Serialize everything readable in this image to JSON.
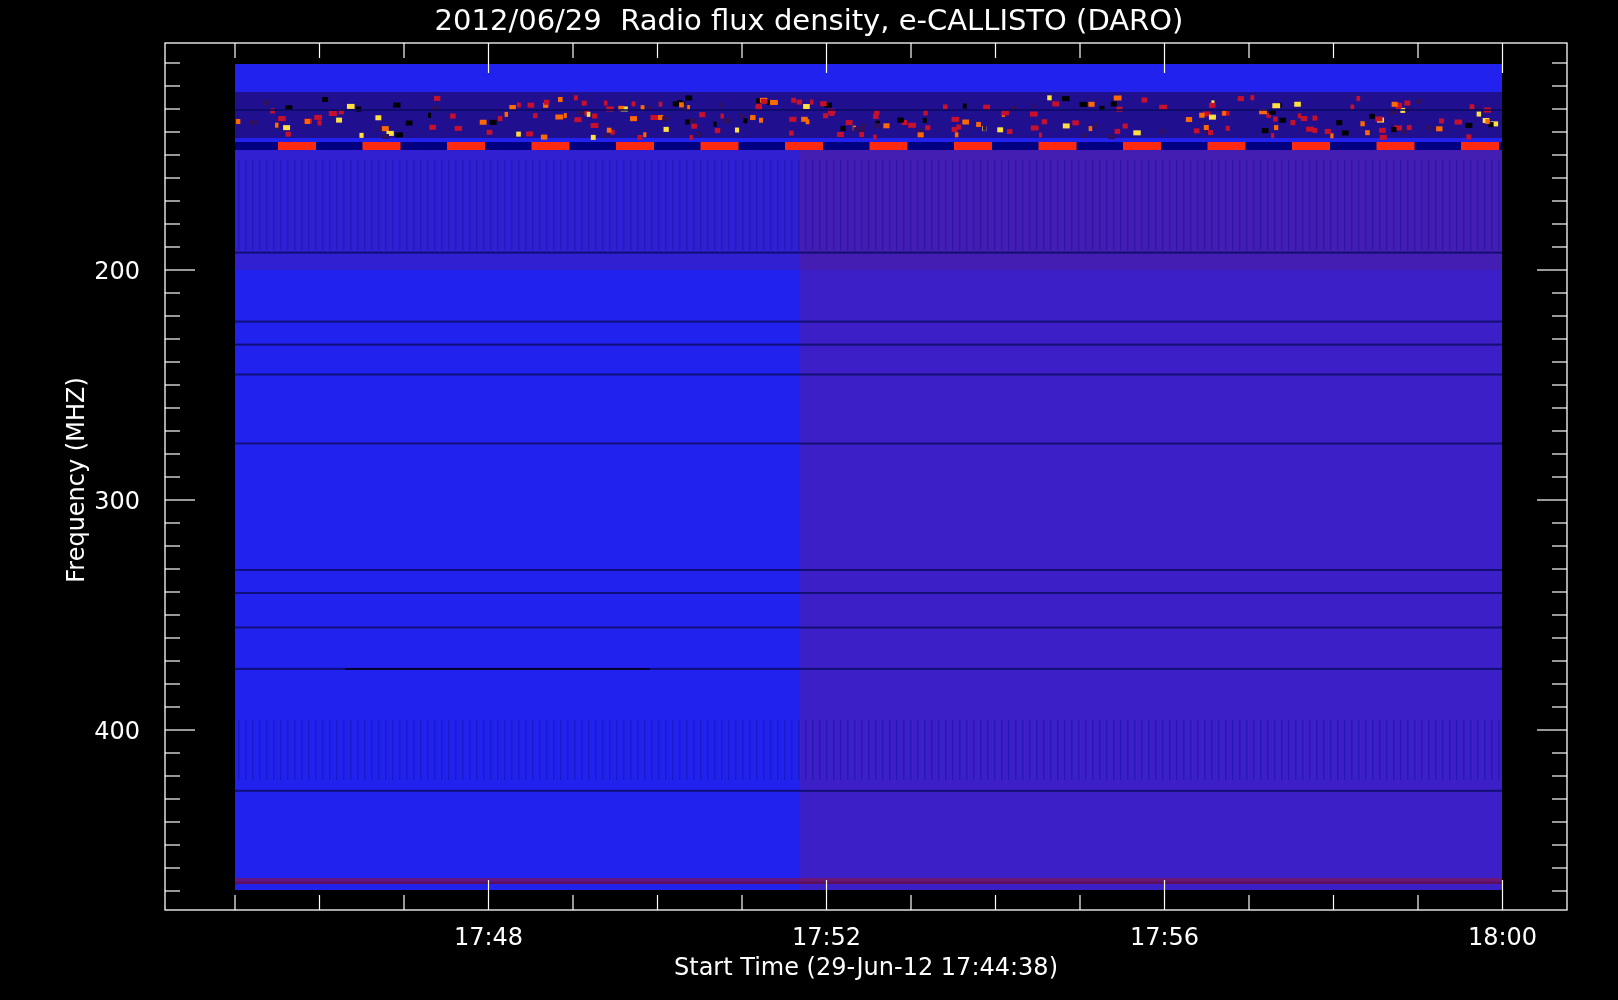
{
  "title": "2012/06/29  Radio flux density, e-CALLISTO (DARO)",
  "y_axis": {
    "label": "Frequency (MHZ)",
    "ticks": [
      "200",
      "300",
      "400"
    ]
  },
  "x_axis": {
    "label": "Start Time (29-Jun-12 17:44:38)",
    "ticks": [
      "17:48",
      "17:52",
      "17:56",
      "18:00"
    ]
  }
}
